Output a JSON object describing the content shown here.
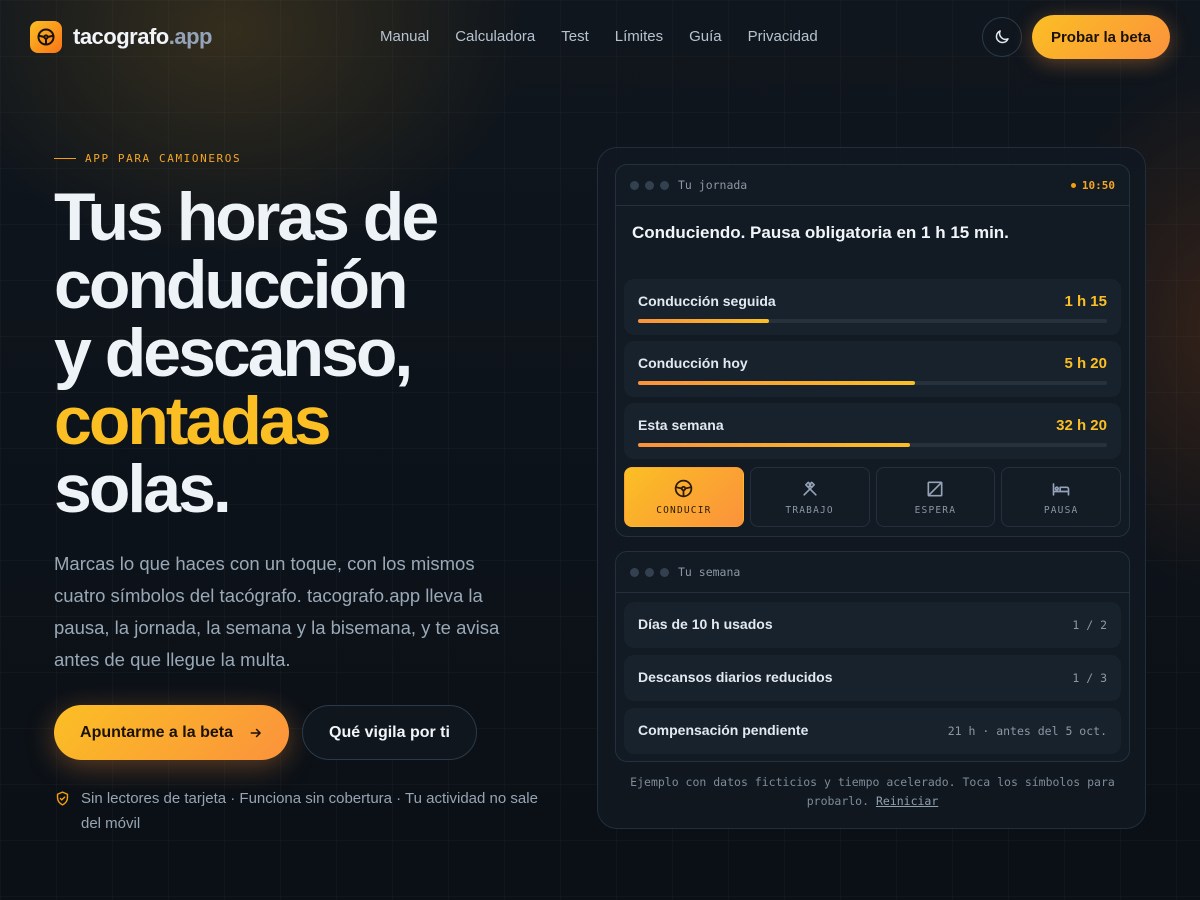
{
  "brand": {
    "name_main": "tacografo",
    "name_suffix": ".app"
  },
  "nav": {
    "items": [
      "Manual",
      "Calculadora",
      "Test",
      "Límites",
      "Guía",
      "Privacidad"
    ]
  },
  "header": {
    "beta_button": "Probar la beta",
    "theme_icon": "moon-icon"
  },
  "hero": {
    "eyebrow": "APP PARA CAMIONEROS",
    "headline_lines": [
      "Tus horas de",
      "conducción",
      "y descanso,"
    ],
    "headline_accent": "contadas",
    "headline_end": "solas.",
    "lede": "Marcas lo que haces con un toque, con los mismos cuatro símbolos del tacógrafo. tacografo.app lleva la pausa, la jornada, la semana y la bisemana, y te avisa antes de que llegue la multa.",
    "cta_primary": "Apuntarme a la beta",
    "cta_secondary": "Qué vigila por ti",
    "trust": "Sin lectores de tarjeta · Funciona sin cobertura · Tu actividad no sale del móvil"
  },
  "day_card": {
    "title": "Tu jornada",
    "clock": "10:50",
    "status": "Conduciendo. Pausa obligatoria en 1 h 15 min.",
    "meters": [
      {
        "label": "Conducción seguida",
        "value": "1 h 15",
        "progress": 0.28
      },
      {
        "label": "Conducción hoy",
        "value": "5 h 20",
        "progress": 0.59
      },
      {
        "label": "Esta semana",
        "value": "32 h 20",
        "progress": 0.58
      }
    ],
    "modes": [
      {
        "label": "CONDUCIR",
        "icon": "steering-wheel-icon",
        "active": true
      },
      {
        "label": "TRABAJO",
        "icon": "hammers-icon",
        "active": false
      },
      {
        "label": "ESPERA",
        "icon": "availability-icon",
        "active": false
      },
      {
        "label": "PAUSA",
        "icon": "bed-icon",
        "active": false
      }
    ]
  },
  "week_card": {
    "title": "Tu semana",
    "rows": [
      {
        "label": "Días de 10 h usados",
        "value": "1 / 2"
      },
      {
        "label": "Descansos diarios reducidos",
        "value": "1 / 3"
      },
      {
        "label": "Compensación pendiente",
        "value": "21 h · antes del 5 oct."
      }
    ]
  },
  "footnote": {
    "text": "Ejemplo con datos ficticios y tiempo acelerado. Toca los símbolos para probarlo.",
    "link": "Reiniciar"
  },
  "colors": {
    "accent": "#fbbf24",
    "accent_2": "#fb923c",
    "background": "#0c1118"
  }
}
